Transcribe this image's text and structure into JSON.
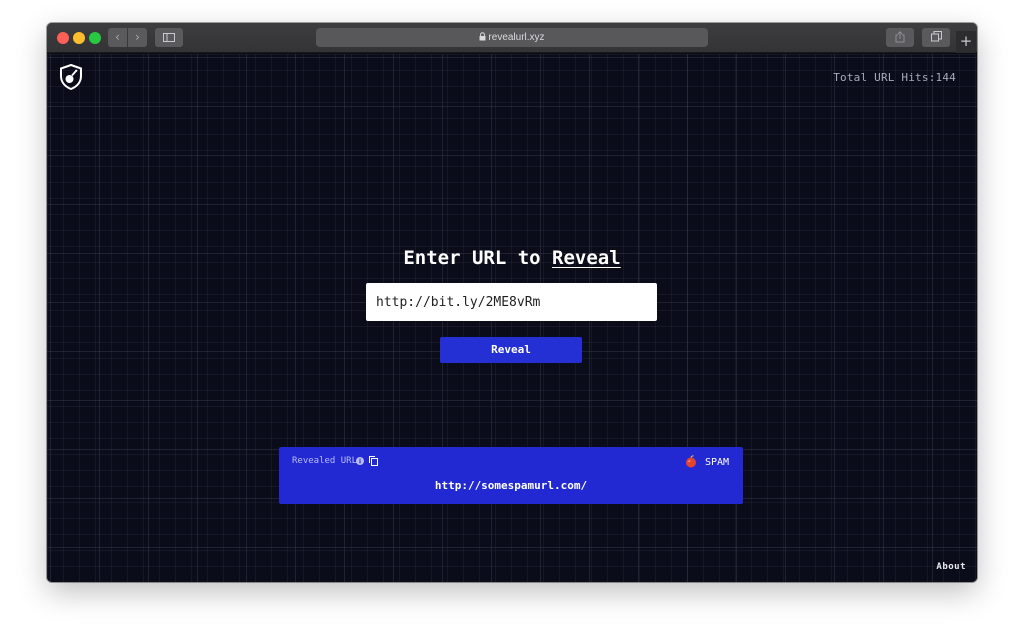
{
  "browser": {
    "address": "revealurl.xyz",
    "nav_back": "‹",
    "nav_forward": "›",
    "new_tab": "+"
  },
  "header": {
    "total_hits": "Total URL Hits:144"
  },
  "main": {
    "heading_prefix": "Enter URL to ",
    "heading_link": "Reveal",
    "input_value": "http://bit.ly/2ME8vRm",
    "reveal_button": "Reveal"
  },
  "result": {
    "label": "Revealed URL",
    "status": "SPAM",
    "url": "http://somespamurl.com/"
  },
  "footer": {
    "about": "About"
  },
  "colors": {
    "accent": "#2228d2",
    "background": "#0b0c1a"
  },
  "icons": [
    "lock-icon",
    "sidebar-icon",
    "share-icon",
    "tabs-icon",
    "shield-logo-icon",
    "info-icon",
    "copy-icon",
    "bomb-icon"
  ]
}
